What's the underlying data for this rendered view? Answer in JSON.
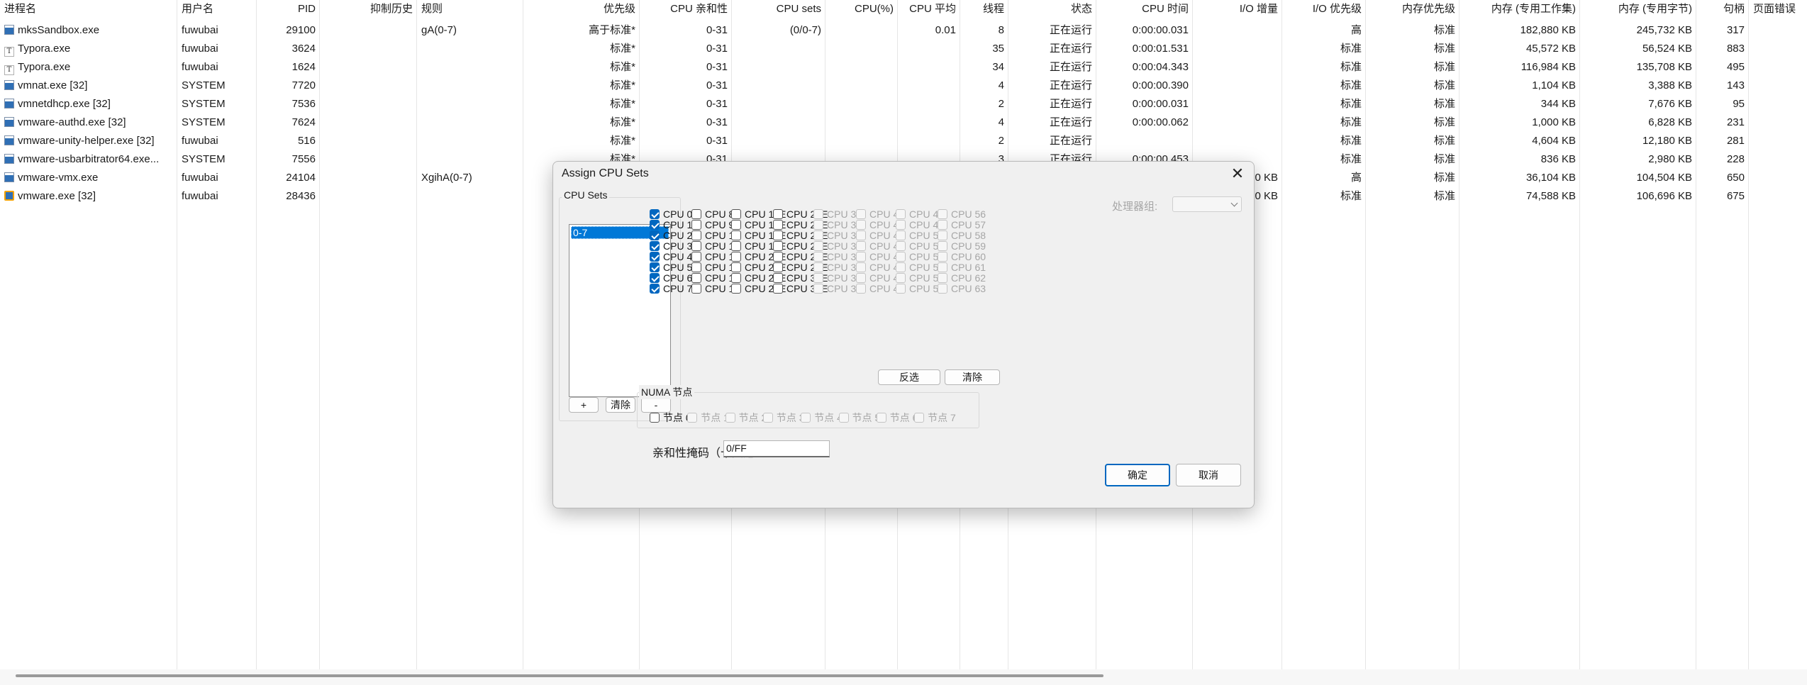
{
  "columns": [
    "进程名",
    "用户名",
    "PID",
    "抑制历史",
    "规则",
    "优先级",
    "CPU 亲和性",
    "CPU sets",
    "CPU(%)",
    "CPU 平均",
    "线程",
    "状态",
    "CPU 时间",
    "I/O 增量",
    "I/O 优先级",
    "内存优先级",
    "内存 (专用工作集)",
    "内存 (专用字节)",
    "句柄",
    "页面错误"
  ],
  "rows": [
    {
      "icon": "app-window-icon",
      "name": "mksSandbox.exe",
      "user": "fuwubai",
      "pid": "29100",
      "suppress": "",
      "rule": "gA(0-7)",
      "priority": "高于标准*",
      "affinity": "0-31",
      "cpusets": "(0/0-7)",
      "cpu": "",
      "cpuavg": "0.01",
      "threads": "8",
      "status": "正在运行",
      "cputime": "0:00:00.031",
      "ioinc": "",
      "iopri": "高",
      "mempri": "标准",
      "memws": "182,880 KB",
      "membytes": "245,732 KB",
      "handles": "317"
    },
    {
      "icon": "typora-icon",
      "name": "Typora.exe",
      "user": "fuwubai",
      "pid": "3624",
      "suppress": "",
      "rule": "",
      "priority": "标准*",
      "affinity": "0-31",
      "cpusets": "",
      "cpu": "",
      "cpuavg": "",
      "threads": "35",
      "status": "正在运行",
      "cputime": "0:00:01.531",
      "ioinc": "",
      "iopri": "标准",
      "mempri": "标准",
      "memws": "45,572 KB",
      "membytes": "56,524 KB",
      "handles": "883"
    },
    {
      "icon": "typora-icon",
      "name": "Typora.exe",
      "user": "fuwubai",
      "pid": "1624",
      "suppress": "",
      "rule": "",
      "priority": "标准*",
      "affinity": "0-31",
      "cpusets": "",
      "cpu": "",
      "cpuavg": "",
      "threads": "34",
      "status": "正在运行",
      "cputime": "0:00:04.343",
      "ioinc": "",
      "iopri": "标准",
      "mempri": "标准",
      "memws": "116,984 KB",
      "membytes": "135,708 KB",
      "handles": "495"
    },
    {
      "icon": "app-window-icon",
      "name": "vmnat.exe [32]",
      "user": "SYSTEM",
      "pid": "7720",
      "suppress": "",
      "rule": "",
      "priority": "标准*",
      "affinity": "0-31",
      "cpusets": "",
      "cpu": "",
      "cpuavg": "",
      "threads": "4",
      "status": "正在运行",
      "cputime": "0:00:00.390",
      "ioinc": "",
      "iopri": "标准",
      "mempri": "标准",
      "memws": "1,104 KB",
      "membytes": "3,388 KB",
      "handles": "143"
    },
    {
      "icon": "app-window-icon",
      "name": "vmnetdhcp.exe [32]",
      "user": "SYSTEM",
      "pid": "7536",
      "suppress": "",
      "rule": "",
      "priority": "标准*",
      "affinity": "0-31",
      "cpusets": "",
      "cpu": "",
      "cpuavg": "",
      "threads": "2",
      "status": "正在运行",
      "cputime": "0:00:00.031",
      "ioinc": "",
      "iopri": "标准",
      "mempri": "标准",
      "memws": "344 KB",
      "membytes": "7,676 KB",
      "handles": "95"
    },
    {
      "icon": "app-window-icon",
      "name": "vmware-authd.exe [32]",
      "user": "SYSTEM",
      "pid": "7624",
      "suppress": "",
      "rule": "",
      "priority": "标准*",
      "affinity": "0-31",
      "cpusets": "",
      "cpu": "",
      "cpuavg": "",
      "threads": "4",
      "status": "正在运行",
      "cputime": "0:00:00.062",
      "ioinc": "",
      "iopri": "标准",
      "mempri": "标准",
      "memws": "1,000 KB",
      "membytes": "6,828 KB",
      "handles": "231"
    },
    {
      "icon": "app-window-icon",
      "name": "vmware-unity-helper.exe [32]",
      "user": "fuwubai",
      "pid": "516",
      "suppress": "",
      "rule": "",
      "priority": "标准*",
      "affinity": "0-31",
      "cpusets": "",
      "cpu": "",
      "cpuavg": "",
      "threads": "2",
      "status": "正在运行",
      "cputime": "",
      "ioinc": "",
      "iopri": "标准",
      "mempri": "标准",
      "memws": "4,604 KB",
      "membytes": "12,180 KB",
      "handles": "281"
    },
    {
      "icon": "app-window-icon",
      "name": "vmware-usbarbitrator64.exe...",
      "user": "SYSTEM",
      "pid": "7556",
      "suppress": "",
      "rule": "",
      "priority": "标准*",
      "affinity": "0-31",
      "cpusets": "",
      "cpu": "",
      "cpuavg": "",
      "threads": "3",
      "status": "正在运行",
      "cputime": "0:00:00.453",
      "ioinc": "",
      "iopri": "标准",
      "mempri": "标准",
      "memws": "836 KB",
      "membytes": "2,980 KB",
      "handles": "228"
    },
    {
      "icon": "app-window-icon",
      "name": "vmware-vmx.exe",
      "user": "fuwubai",
      "pid": "24104",
      "suppress": "",
      "rule": "XgihA(0-7)",
      "priority": "",
      "affinity": "",
      "cpusets": "",
      "cpu": "",
      "cpuavg": "",
      "threads": "",
      "status": "",
      "cputime": "",
      "ioinc": "0 KB",
      "iopri": "高",
      "mempri": "标准",
      "memws": "36,104 KB",
      "membytes": "104,504 KB",
      "handles": "650"
    },
    {
      "icon": "vmware-icon",
      "name": "vmware.exe [32]",
      "user": "fuwubai",
      "pid": "28436",
      "suppress": "",
      "rule": "",
      "priority": "",
      "affinity": "",
      "cpusets": "",
      "cpu": "",
      "cpuavg": "",
      "threads": "",
      "status": "",
      "cputime": "",
      "ioinc": "0 KB",
      "iopri": "标准",
      "mempri": "标准",
      "memws": "74,588 KB",
      "membytes": "106,696 KB",
      "handles": "675"
    }
  ],
  "dialog": {
    "title": "Assign CPU Sets",
    "close_glyph": "✕",
    "cpu_sets_label": "CPU Sets",
    "cpu_sets_list": [
      "0-7"
    ],
    "add_label": "+",
    "clear_label": "清除",
    "remove_label": "-",
    "processor_group_label": "处理器组:",
    "cpus": [
      {
        "label": "CPU 0",
        "checked": true,
        "enabled": true
      },
      {
        "label": "CPU 1",
        "checked": true,
        "enabled": true
      },
      {
        "label": "CPU 2",
        "checked": true,
        "enabled": true
      },
      {
        "label": "CPU 3",
        "checked": true,
        "enabled": true
      },
      {
        "label": "CPU 4",
        "checked": true,
        "enabled": true
      },
      {
        "label": "CPU 5",
        "checked": true,
        "enabled": true
      },
      {
        "label": "CPU 6",
        "checked": true,
        "enabled": true
      },
      {
        "label": "CPU 7",
        "checked": true,
        "enabled": true
      },
      {
        "label": "CPU 8",
        "checked": false,
        "enabled": true
      },
      {
        "label": "CPU 9",
        "checked": false,
        "enabled": true
      },
      {
        "label": "CPU 10",
        "checked": false,
        "enabled": true
      },
      {
        "label": "CPU 11",
        "checked": false,
        "enabled": true
      },
      {
        "label": "CPU 12",
        "checked": false,
        "enabled": true
      },
      {
        "label": "CPU 13",
        "checked": false,
        "enabled": true
      },
      {
        "label": "CPU 14",
        "checked": false,
        "enabled": true
      },
      {
        "label": "CPU 15",
        "checked": false,
        "enabled": true
      },
      {
        "label": "CPU 16E",
        "checked": false,
        "enabled": true
      },
      {
        "label": "CPU 17E",
        "checked": false,
        "enabled": true
      },
      {
        "label": "CPU 18E",
        "checked": false,
        "enabled": true
      },
      {
        "label": "CPU 19E",
        "checked": false,
        "enabled": true
      },
      {
        "label": "CPU 20E",
        "checked": false,
        "enabled": true
      },
      {
        "label": "CPU 21E",
        "checked": false,
        "enabled": true
      },
      {
        "label": "CPU 22E",
        "checked": false,
        "enabled": true
      },
      {
        "label": "CPU 23E",
        "checked": false,
        "enabled": true
      },
      {
        "label": "CPU 24E",
        "checked": false,
        "enabled": true
      },
      {
        "label": "CPU 25E",
        "checked": false,
        "enabled": true
      },
      {
        "label": "CPU 26E",
        "checked": false,
        "enabled": true
      },
      {
        "label": "CPU 27E",
        "checked": false,
        "enabled": true
      },
      {
        "label": "CPU 28E",
        "checked": false,
        "enabled": true
      },
      {
        "label": "CPU 29E",
        "checked": false,
        "enabled": true
      },
      {
        "label": "CPU 30E",
        "checked": false,
        "enabled": true
      },
      {
        "label": "CPU 31E",
        "checked": false,
        "enabled": true
      },
      {
        "label": "CPU 32",
        "checked": false,
        "enabled": false
      },
      {
        "label": "CPU 33",
        "checked": false,
        "enabled": false
      },
      {
        "label": "CPU 34",
        "checked": false,
        "enabled": false
      },
      {
        "label": "CPU 35",
        "checked": false,
        "enabled": false
      },
      {
        "label": "CPU 36",
        "checked": false,
        "enabled": false
      },
      {
        "label": "CPU 37",
        "checked": false,
        "enabled": false
      },
      {
        "label": "CPU 38",
        "checked": false,
        "enabled": false
      },
      {
        "label": "CPU 39",
        "checked": false,
        "enabled": false
      },
      {
        "label": "CPU 40",
        "checked": false,
        "enabled": false
      },
      {
        "label": "CPU 41",
        "checked": false,
        "enabled": false
      },
      {
        "label": "CPU 42",
        "checked": false,
        "enabled": false
      },
      {
        "label": "CPU 43",
        "checked": false,
        "enabled": false
      },
      {
        "label": "CPU 44",
        "checked": false,
        "enabled": false
      },
      {
        "label": "CPU 45",
        "checked": false,
        "enabled": false
      },
      {
        "label": "CPU 46",
        "checked": false,
        "enabled": false
      },
      {
        "label": "CPU 47",
        "checked": false,
        "enabled": false
      },
      {
        "label": "CPU 48",
        "checked": false,
        "enabled": false
      },
      {
        "label": "CPU 49",
        "checked": false,
        "enabled": false
      },
      {
        "label": "CPU 50",
        "checked": false,
        "enabled": false
      },
      {
        "label": "CPU 51",
        "checked": false,
        "enabled": false
      },
      {
        "label": "CPU 52",
        "checked": false,
        "enabled": false
      },
      {
        "label": "CPU 53",
        "checked": false,
        "enabled": false
      },
      {
        "label": "CPU 54",
        "checked": false,
        "enabled": false
      },
      {
        "label": "CPU 55",
        "checked": false,
        "enabled": false
      },
      {
        "label": "CPU 56",
        "checked": false,
        "enabled": false
      },
      {
        "label": "CPU 57",
        "checked": false,
        "enabled": false
      },
      {
        "label": "CPU 58",
        "checked": false,
        "enabled": false
      },
      {
        "label": "CPU 59",
        "checked": false,
        "enabled": false
      },
      {
        "label": "CPU 60",
        "checked": false,
        "enabled": false
      },
      {
        "label": "CPU 61",
        "checked": false,
        "enabled": false
      },
      {
        "label": "CPU 62",
        "checked": false,
        "enabled": false
      },
      {
        "label": "CPU 63",
        "checked": false,
        "enabled": false
      }
    ],
    "invert_label": "反选",
    "clear_cpus_label": "清除",
    "numa_label": "NUMA 节点",
    "numa_nodes": [
      {
        "label": "节点 0",
        "checked": false,
        "enabled": true
      },
      {
        "label": "节点 1",
        "checked": false,
        "enabled": false
      },
      {
        "label": "节点 2",
        "checked": false,
        "enabled": false
      },
      {
        "label": "节点 3",
        "checked": false,
        "enabled": false
      },
      {
        "label": "节点 4",
        "checked": false,
        "enabled": false
      },
      {
        "label": "节点 5",
        "checked": false,
        "enabled": false
      },
      {
        "label": "节点 6",
        "checked": false,
        "enabled": false
      },
      {
        "label": "节点 7",
        "checked": false,
        "enabled": false
      }
    ],
    "mask_label": "亲和性掩码（十六进",
    "mask_value": "0/FF",
    "ok_label": "确定",
    "cancel_label": "取消"
  }
}
